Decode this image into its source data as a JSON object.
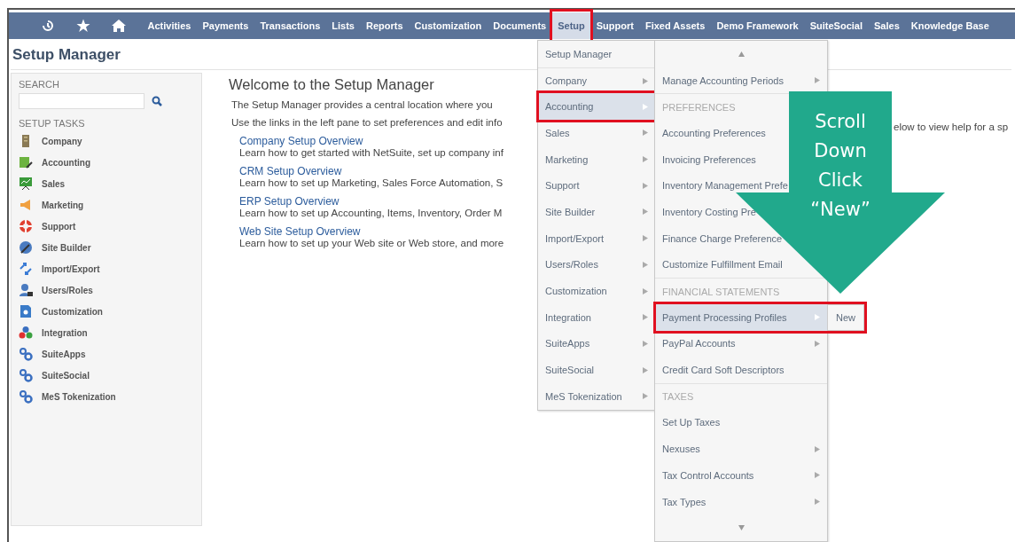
{
  "nav": {
    "items": [
      {
        "label": "Activities",
        "selected": false,
        "highlighted": false
      },
      {
        "label": "Payments",
        "selected": false,
        "highlighted": false
      },
      {
        "label": "Transactions",
        "selected": false,
        "highlighted": false
      },
      {
        "label": "Lists",
        "selected": false,
        "highlighted": false
      },
      {
        "label": "Reports",
        "selected": false,
        "highlighted": false
      },
      {
        "label": "Customization",
        "selected": false,
        "highlighted": false
      },
      {
        "label": "Documents",
        "selected": false,
        "highlighted": false
      },
      {
        "label": "Setup",
        "selected": true,
        "highlighted": true
      },
      {
        "label": "Support",
        "selected": false,
        "highlighted": false
      },
      {
        "label": "Fixed Assets",
        "selected": false,
        "highlighted": false
      },
      {
        "label": "Demo Framework",
        "selected": false,
        "highlighted": false
      },
      {
        "label": "SuiteSocial",
        "selected": false,
        "highlighted": false
      },
      {
        "label": "Sales",
        "selected": false,
        "highlighted": false
      },
      {
        "label": "Knowledge Base",
        "selected": false,
        "highlighted": false
      }
    ]
  },
  "page_title": "Setup Manager",
  "sidebar": {
    "search_label": "SEARCH",
    "tasks_label": "SETUP TASKS",
    "items": [
      {
        "label": "Company"
      },
      {
        "label": "Accounting"
      },
      {
        "label": "Sales"
      },
      {
        "label": "Marketing"
      },
      {
        "label": "Support"
      },
      {
        "label": "Site Builder"
      },
      {
        "label": "Import/Export"
      },
      {
        "label": "Users/Roles"
      },
      {
        "label": "Customization"
      },
      {
        "label": "Integration"
      },
      {
        "label": "SuiteApps"
      },
      {
        "label": "SuiteSocial"
      },
      {
        "label": "MeS Tokenization"
      }
    ]
  },
  "main": {
    "title": "Welcome to the Setup Manager",
    "intro": [
      "The Setup Manager provides a central location where you",
      "Use the links in the left pane to set preferences and edit info"
    ],
    "intro_tail": "elow to view help for a sp",
    "sections": [
      {
        "link": "Company Setup Overview",
        "text": "Learn how to get started with NetSuite, set up company inf"
      },
      {
        "link": "CRM Setup Overview",
        "text": "Learn how to set up Marketing, Sales Force Automation, S"
      },
      {
        "link": "ERP Setup Overview",
        "text": "Learn how to set up Accounting, Items, Inventory, Order M"
      },
      {
        "link": "Web Site Setup Overview",
        "text": "Learn how to set up your Web site or Web store, and more"
      }
    ]
  },
  "setup_menu": {
    "items": [
      {
        "kind": "item",
        "label": "Setup Manager",
        "submenu": false,
        "selected": false,
        "highlighted": false
      },
      {
        "kind": "item",
        "label": "Company",
        "submenu": true,
        "selected": false,
        "highlighted": false
      },
      {
        "kind": "item",
        "label": "Accounting",
        "submenu": true,
        "selected": true,
        "highlighted": true
      },
      {
        "kind": "item",
        "label": "Sales",
        "submenu": true,
        "selected": false,
        "highlighted": false
      },
      {
        "kind": "item",
        "label": "Marketing",
        "submenu": true,
        "selected": false,
        "highlighted": false
      },
      {
        "kind": "item",
        "label": "Support",
        "submenu": true,
        "selected": false,
        "highlighted": false
      },
      {
        "kind": "item",
        "label": "Site Builder",
        "submenu": true,
        "selected": false,
        "highlighted": false
      },
      {
        "kind": "item",
        "label": "Import/Export",
        "submenu": true,
        "selected": false,
        "highlighted": false
      },
      {
        "kind": "item",
        "label": "Users/Roles",
        "submenu": true,
        "selected": false,
        "highlighted": false
      },
      {
        "kind": "item",
        "label": "Customization",
        "submenu": true,
        "selected": false,
        "highlighted": false
      },
      {
        "kind": "item",
        "label": "Integration",
        "submenu": true,
        "selected": false,
        "highlighted": false
      },
      {
        "kind": "item",
        "label": "SuiteApps",
        "submenu": true,
        "selected": false,
        "highlighted": false
      },
      {
        "kind": "item",
        "label": "SuiteSocial",
        "submenu": true,
        "selected": false,
        "highlighted": false
      },
      {
        "kind": "item",
        "label": "MeS Tokenization",
        "submenu": true,
        "selected": false,
        "highlighted": false
      }
    ]
  },
  "accounting_menu": {
    "items": [
      {
        "kind": "scroll_up"
      },
      {
        "kind": "item",
        "label": "Manage Accounting Periods",
        "submenu": true,
        "selected": false,
        "highlighted": false
      },
      {
        "kind": "header",
        "label": "PREFERENCES"
      },
      {
        "kind": "item",
        "label": "Accounting Preferences",
        "selected": false,
        "highlighted": false
      },
      {
        "kind": "item",
        "label": "Invoicing Preferences",
        "selected": false,
        "highlighted": false
      },
      {
        "kind": "item",
        "label": "Inventory Management Prefe",
        "selected": false,
        "highlighted": false
      },
      {
        "kind": "item",
        "label": "Inventory Costing Pre",
        "selected": false,
        "highlighted": false
      },
      {
        "kind": "item",
        "label": "Finance Charge Preference",
        "selected": false,
        "highlighted": false
      },
      {
        "kind": "item",
        "label": "Customize Fulfillment Email",
        "selected": false,
        "highlighted": false
      },
      {
        "kind": "header",
        "label": "FINANCIAL STATEMENTS"
      },
      {
        "kind": "item",
        "label": "Payment Processing Profiles",
        "submenu": true,
        "selected": true,
        "highlighted": true,
        "flyout": "New"
      },
      {
        "kind": "item",
        "label": "PayPal Accounts",
        "submenu": true,
        "selected": false,
        "highlighted": false
      },
      {
        "kind": "item",
        "label": "Credit Card Soft Descriptors",
        "submenu": false,
        "selected": false,
        "highlighted": false
      },
      {
        "kind": "header",
        "label": "TAXES"
      },
      {
        "kind": "item",
        "label": "Set Up Taxes",
        "submenu": false,
        "selected": false,
        "highlighted": false
      },
      {
        "kind": "item",
        "label": "Nexuses",
        "submenu": true,
        "selected": false,
        "highlighted": false
      },
      {
        "kind": "item",
        "label": "Tax Control Accounts",
        "submenu": true,
        "selected": false,
        "highlighted": false
      },
      {
        "kind": "item",
        "label": "Tax Types",
        "submenu": true,
        "selected": false,
        "highlighted": false
      },
      {
        "kind": "scroll_down"
      }
    ]
  },
  "callout": {
    "lines": [
      "Scroll",
      "Down",
      "Click",
      "“New”"
    ]
  }
}
